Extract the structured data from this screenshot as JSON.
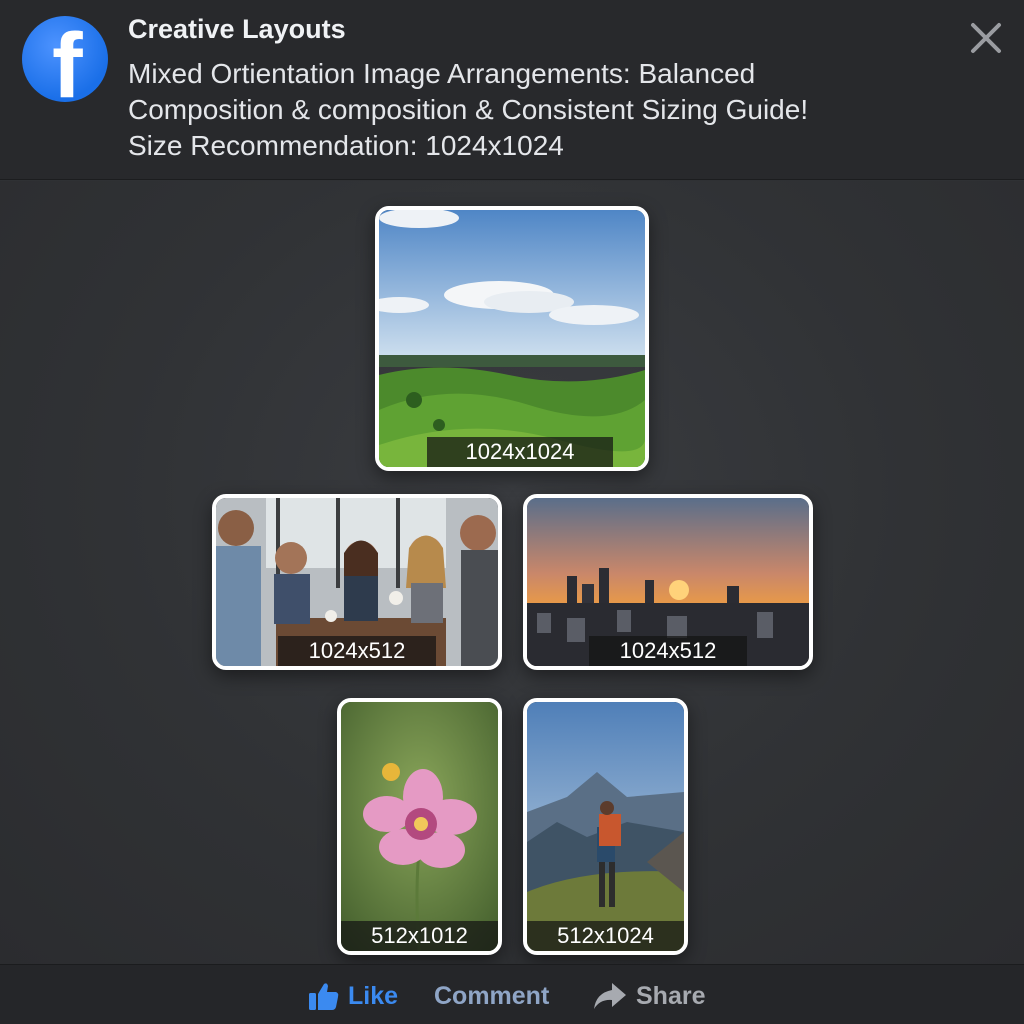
{
  "header": {
    "logo_glyph": "f",
    "page_name": "Creative Layouts",
    "post_title": "Mixed Ortientation Image Arrangements: Balanced Composition & composition & Consistent Sizing Guide! Size Recommendation: 1024x1024",
    "close_icon": "close-icon"
  },
  "tiles": [
    {
      "label": "1024x1024",
      "subject": "green rolling hills under blue sky with clouds"
    },
    {
      "label": "1024x512",
      "subject": "group of friends laughing at a cafe table"
    },
    {
      "label": "1024x512",
      "subject": "city skyline at sunset"
    },
    {
      "label": "512x1012",
      "subject": "pink flower on green background"
    },
    {
      "label": "512x1024",
      "subject": "hiker with backpack facing mountains"
    }
  ],
  "actions": {
    "like": {
      "label": "Like",
      "icon": "thumbs-up-icon"
    },
    "comment": {
      "label": "Comment"
    },
    "share": {
      "label": "Share",
      "icon": "share-arrow-icon"
    }
  },
  "colors": {
    "brand": "#1a6fe8",
    "like": "#3b8af0",
    "background": "#2f3134"
  }
}
